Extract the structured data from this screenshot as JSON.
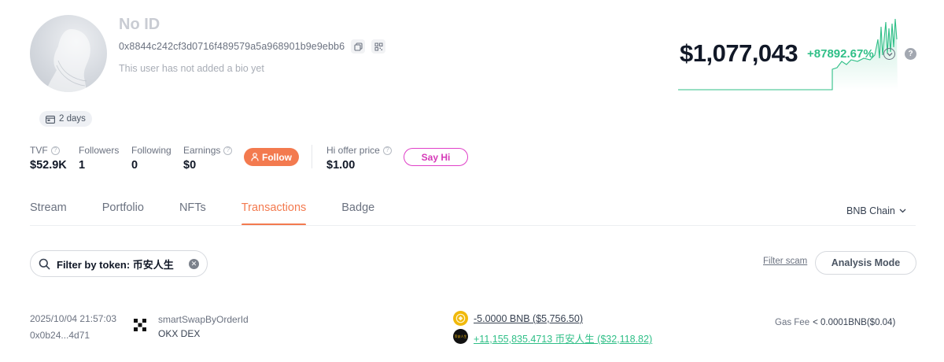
{
  "profile": {
    "name": "No ID",
    "address": "0x8844c242cf3d0716f489579a5a968901b9e9ebb6",
    "bio": "This user has not added a bio yet",
    "age_badge": "2 days"
  },
  "stats": {
    "tvf": {
      "label": "TVF",
      "value": "$52.9K"
    },
    "followers": {
      "label": "Followers",
      "value": "1"
    },
    "following": {
      "label": "Following",
      "value": "0"
    },
    "earnings": {
      "label": "Earnings",
      "value": "$0"
    },
    "hi_offer": {
      "label": "Hi offer price",
      "value": "$1.00"
    }
  },
  "buttons": {
    "follow": "Follow",
    "say_hi": "Say Hi",
    "analysis_mode": "Analysis Mode",
    "filter_scam": "Filter scam"
  },
  "portfolio": {
    "balance": "$1,077,043",
    "change": "+87892.67%"
  },
  "tabs": [
    {
      "label": "Stream",
      "active": false
    },
    {
      "label": "Portfolio",
      "active": false
    },
    {
      "label": "NFTs",
      "active": false
    },
    {
      "label": "Transactions",
      "active": true
    },
    {
      "label": "Badge",
      "active": false
    }
  ],
  "chain_selector": "BNB Chain",
  "filter": {
    "text": "Filter by token: 币安人生"
  },
  "transaction": {
    "datetime": "2025/10/04 21:57:03",
    "hash": "0x0b24...4d71",
    "method": "smartSwapByOrderId",
    "dex": "OKX DEX",
    "amount_out": "-5.0000 BNB ($5,756.50)",
    "amount_in": "+11,155,835.4713 币安人生 ($32,118.82)",
    "token_in_icon_text": "币安人生",
    "gas_label": "Gas Fee",
    "gas_value": "< 0.0001BNB($0.04)"
  },
  "colors": {
    "accent": "#f37a4f",
    "positive": "#2fbf87",
    "sayhi": "#d63ab8",
    "bnb": "#f0b90b"
  },
  "icons": [
    "copy-icon",
    "qrcode-icon",
    "calendar-icon",
    "question-icon",
    "user-icon",
    "chevron-down-icon",
    "close-icon",
    "okx-logo-icon",
    "bnb-token-icon"
  ]
}
